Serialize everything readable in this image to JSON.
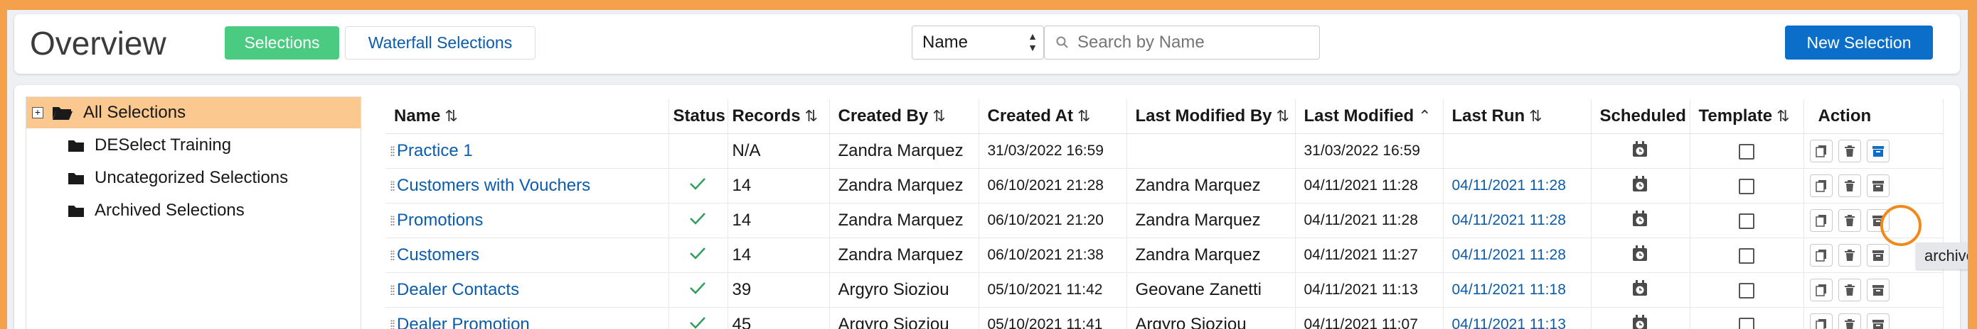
{
  "header": {
    "title": "Overview",
    "tab_selections": "Selections",
    "tab_waterfall": "Waterfall Selections",
    "sort_field": "Name",
    "search_placeholder": "Search by Name",
    "new_selection": "New Selection"
  },
  "tree": {
    "root": "All Selections",
    "folders": [
      "DESelect Training",
      "Uncategorized Selections",
      "Archived Selections"
    ]
  },
  "table": {
    "columns": [
      "Name",
      "Status",
      "Records",
      "Created By",
      "Created At",
      "Last Modified By",
      "Last Modified",
      "Last Run",
      "Scheduled",
      "Template",
      "Action"
    ],
    "rows": [
      {
        "name": "Practice 1",
        "status": "",
        "records": "N/A",
        "created_by": "Zandra Marquez",
        "created_at": "31/03/2022 16:59",
        "modified_by": "",
        "modified": "31/03/2022 16:59",
        "last_run": ""
      },
      {
        "name": "Customers with Vouchers",
        "status": "check",
        "records": "14",
        "created_by": "Zandra Marquez",
        "created_at": "06/10/2021 21:28",
        "modified_by": "Zandra Marquez",
        "modified": "04/11/2021 11:28",
        "last_run": "04/11/2021 11:28"
      },
      {
        "name": "Promotions",
        "status": "check",
        "records": "14",
        "created_by": "Zandra Marquez",
        "created_at": "06/10/2021 21:20",
        "modified_by": "Zandra Marquez",
        "modified": "04/11/2021 11:28",
        "last_run": "04/11/2021 11:28"
      },
      {
        "name": "Customers",
        "status": "check",
        "records": "14",
        "created_by": "Zandra Marquez",
        "created_at": "06/10/2021 21:38",
        "modified_by": "Zandra Marquez",
        "modified": "04/11/2021 11:27",
        "last_run": "04/11/2021 11:28"
      },
      {
        "name": "Dealer Contacts",
        "status": "check",
        "records": "39",
        "created_by": "Argyro Sioziou",
        "created_at": "05/10/2021 11:42",
        "modified_by": "Geovane Zanetti",
        "modified": "04/11/2021 11:13",
        "last_run": "04/11/2021 11:18"
      },
      {
        "name": "Dealer Promotion",
        "status": "check",
        "records": "45",
        "created_by": "Argyro Sioziou",
        "created_at": "05/10/2021 11:41",
        "modified_by": "Argyro Sioziou",
        "modified": "04/11/2021 11:07",
        "last_run": "04/11/2021 11:13"
      }
    ]
  },
  "tooltip": "archive",
  "colors": {
    "accent": "#f5a04a",
    "link": "#0b5cab",
    "success": "#4bca81",
    "primary": "#0b6fc9",
    "tree_selected": "#fbc88f"
  }
}
